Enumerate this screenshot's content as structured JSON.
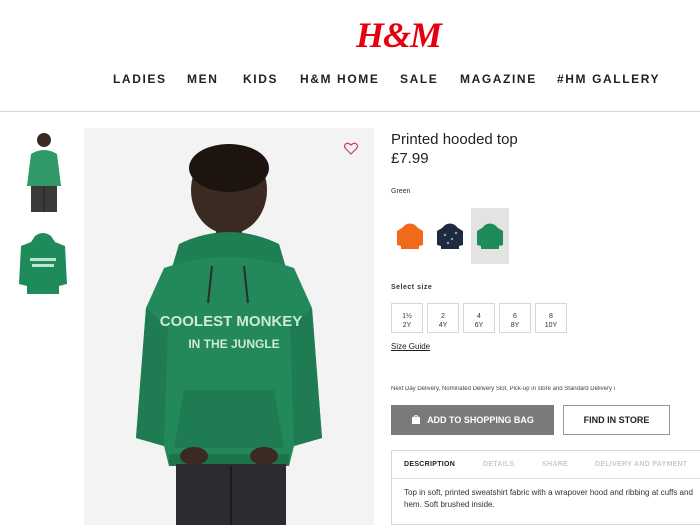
{
  "header": {
    "logo": "H&M",
    "nav": [
      "LADIES",
      "MEN",
      "KIDS",
      "H&M HOME",
      "SALE",
      "MAGAZINE",
      "#HM GALLERY"
    ]
  },
  "product": {
    "title": "Printed hooded top",
    "price": "£7.99",
    "color_label": "Green",
    "swatches": [
      {
        "name": "orange",
        "color": "#f06a1a"
      },
      {
        "name": "navy",
        "color": "#1f2a40"
      },
      {
        "name": "green",
        "color": "#1f8a5a"
      }
    ],
    "hoodie_print_line1": "COOLEST MONKEY",
    "hoodie_print_line2": "IN THE JUNGLE",
    "size_label": "Select size",
    "sizes": [
      {
        "top": "1½",
        "bottom": "2Y"
      },
      {
        "top": "2",
        "bottom": "4Y"
      },
      {
        "top": "4",
        "bottom": "6Y"
      },
      {
        "top": "6",
        "bottom": "8Y"
      },
      {
        "top": "8",
        "bottom": "10Y"
      }
    ],
    "size_guide": "Size Guide",
    "delivery_text": "Next Day Delivery, Nominated Delivery Slot, Pick-up in store and Standard Delivery i",
    "add_to_bag": "ADD TO SHOPPING BAG",
    "find_in_store": "FIND IN STORE",
    "tabs": [
      "DESCRIPTION",
      "DETAILS",
      "SHARE",
      "DELIVERY AND PAYMENT"
    ],
    "description": "Top in soft, printed sweatshirt fabric with a wrapover hood and ribbing at cuffs and hem. Soft brushed inside."
  },
  "colors": {
    "brand_red": "#e50010",
    "hoodie_green": "#1f8a5a",
    "button_grey": "#7a7a7a"
  }
}
